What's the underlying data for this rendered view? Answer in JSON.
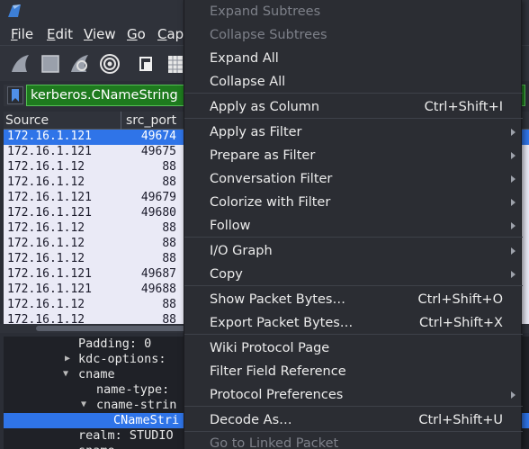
{
  "menubar": {
    "file": "File",
    "edit": "Edit",
    "view": "View",
    "go": "Go",
    "capture": "Capt"
  },
  "toolbar": {
    "icons": [
      "shark-fin-start-icon",
      "stop-square-icon",
      "shark-fin-restart-icon",
      "gear-options-icon",
      "open-file-icon",
      "file-grid-icon"
    ]
  },
  "filter": {
    "value": "kerberos.CNameString"
  },
  "packet_list": {
    "columns": [
      "Source",
      "src_port"
    ],
    "rows": [
      {
        "source": "172.16.1.121",
        "port": "49674",
        "selected": true
      },
      {
        "source": "172.16.1.121",
        "port": "49675"
      },
      {
        "source": "172.16.1.12",
        "port": "88"
      },
      {
        "source": "172.16.1.12",
        "port": "88"
      },
      {
        "source": "172.16.1.121",
        "port": "49679"
      },
      {
        "source": "172.16.1.121",
        "port": "49680"
      },
      {
        "source": "172.16.1.12",
        "port": "88"
      },
      {
        "source": "172.16.1.12",
        "port": "88"
      },
      {
        "source": "172.16.1.12",
        "port": "88"
      },
      {
        "source": "172.16.1.121",
        "port": "49687"
      },
      {
        "source": "172.16.1.121",
        "port": "49688"
      },
      {
        "source": "172.16.1.12",
        "port": "88"
      },
      {
        "source": "172.16.1.12",
        "port": "88"
      }
    ]
  },
  "details": {
    "rows": [
      {
        "text": "Padding: 0"
      },
      {
        "text": "kdc-options:"
      },
      {
        "text": "cname"
      },
      {
        "text": "name-type:"
      },
      {
        "text": "cname-strin"
      },
      {
        "text": "CNameStri"
      },
      {
        "text": "realm: STUDIO"
      },
      {
        "text": "sname"
      }
    ]
  },
  "context_menu": {
    "expand_subtrees": "Expand Subtrees",
    "collapse_subtrees": "Collapse Subtrees",
    "expand_all": "Expand All",
    "collapse_all": "Collapse All",
    "apply_as_column": "Apply as Column",
    "apply_as_column_sc": "Ctrl+Shift+I",
    "apply_as_filter": "Apply as Filter",
    "prepare_as_filter": "Prepare as Filter",
    "conversation_filter": "Conversation Filter",
    "colorize_with_filter": "Colorize with Filter",
    "follow": "Follow",
    "io_graph": "I/O Graph",
    "copy": "Copy",
    "show_packet_bytes": "Show Packet Bytes…",
    "show_packet_bytes_sc": "Ctrl+Shift+O",
    "export_packet_bytes": "Export Packet Bytes…",
    "export_packet_bytes_sc": "Ctrl+Shift+X",
    "wiki_protocol_page": "Wiki Protocol Page",
    "filter_field_reference": "Filter Field Reference",
    "protocol_preferences": "Protocol Preferences",
    "decode_as": "Decode As…",
    "decode_as_sc": "Ctrl+Shift+U",
    "go_to_linked_packet": "Go to Linked Packet"
  },
  "colors": {
    "selection": "#2f74e8",
    "filter_valid": "#1e7a1e",
    "menu_bg": "#2b2d33",
    "packet_bg": "#eaeaf6"
  }
}
